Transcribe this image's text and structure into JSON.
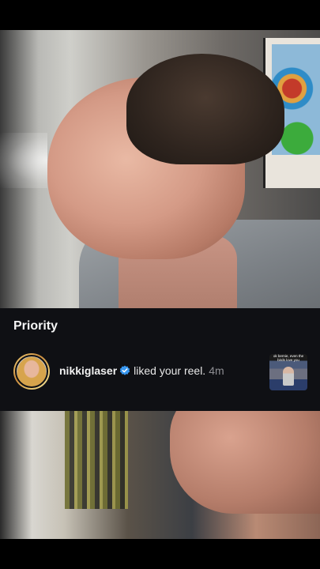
{
  "notifications": {
    "section_title": "Priority",
    "items": [
      {
        "username": "nikkiglaser",
        "verified": true,
        "action": "liked your reel.",
        "time": "4m",
        "thumbnail_caption": "ok bernie, even the birds love you"
      }
    ]
  },
  "colors": {
    "card_background": "#0f1014",
    "verified_badge": "#3897f0",
    "timestamp": "#8e8e93"
  },
  "icons": {
    "verified": "verified-badge-icon"
  }
}
